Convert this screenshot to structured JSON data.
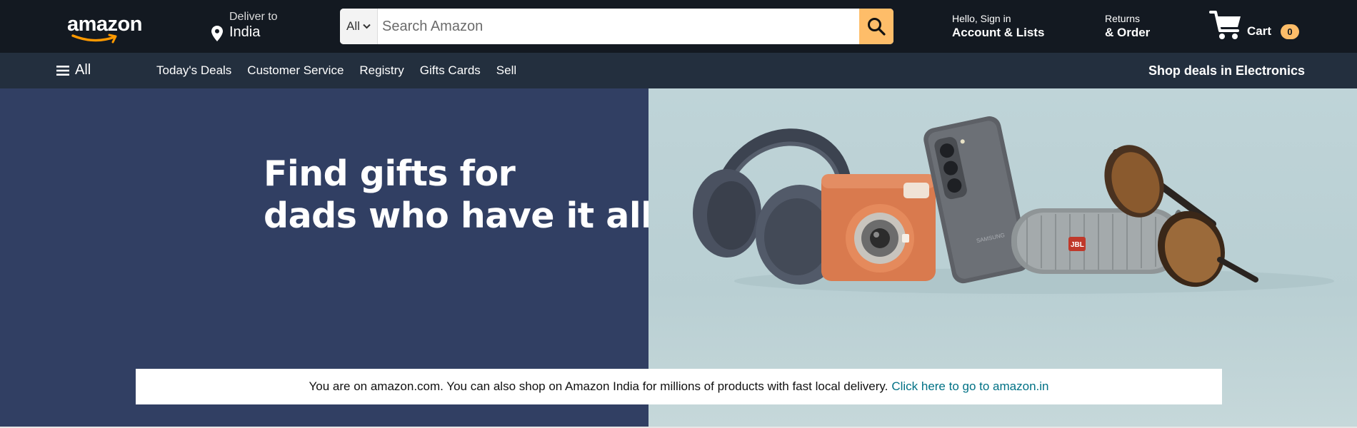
{
  "header": {
    "logo_text": "amazon",
    "deliver_label": "Deliver to",
    "deliver_country": "India",
    "search": {
      "department": "All",
      "placeholder": "Search Amazon"
    },
    "account": {
      "greeting": "Hello, Sign in",
      "label": "Account & Lists"
    },
    "returns": {
      "line1": "Returns",
      "line2": "& Order"
    },
    "cart": {
      "label": "Cart",
      "count": "0"
    }
  },
  "nav": {
    "all_label": "All",
    "links": [
      "Today's Deals",
      "Customer Service",
      "Registry",
      "Gifts Cards",
      "Sell"
    ],
    "promo": "Shop deals in Electronics"
  },
  "hero": {
    "title_line1": "Find gifts for",
    "title_line2": "dads who have it all",
    "product_icons": [
      "headphones-icon",
      "instant-camera-icon",
      "smartphone-icon",
      "speaker-icon",
      "sunglasses-icon"
    ],
    "speaker_brand": "JBL",
    "phone_brand": "SAMSUNG"
  },
  "notice": {
    "text": "You are on amazon.com. You can also shop on Amazon India for millions of products with fast local delivery.",
    "link": "Click here to go to amazon.in"
  },
  "colors": {
    "header_bg": "#131921",
    "subnav_bg": "#232f3e",
    "accent": "#febd69",
    "hero_left": "#313f63",
    "link": "#007185"
  }
}
